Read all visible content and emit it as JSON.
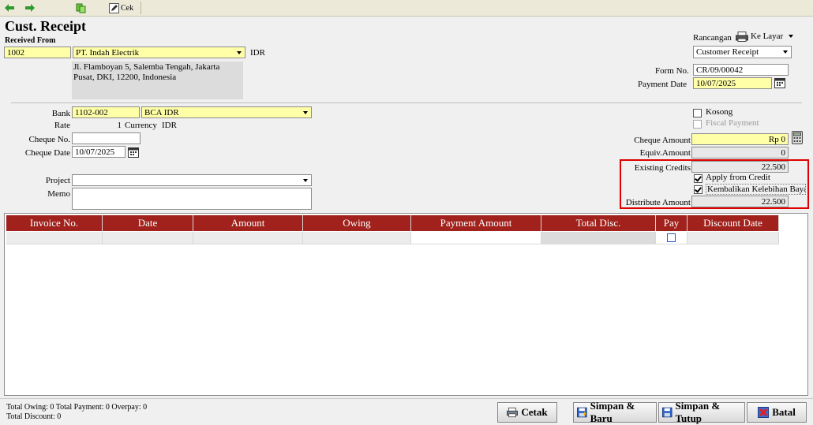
{
  "toolbar": {
    "cek_label": "Cek"
  },
  "header": {
    "title": "Cust. Receipt",
    "received_from_label": "Received From",
    "customer_code": "1002",
    "customer_name": "PT. Indah Electrik",
    "currency": "IDR",
    "address_line1": "Jl. Flamboyan 5, Salemba Tengah, Jakarta",
    "address_line2": "Pusat, DKI, 12200, Indonesia",
    "rancangan_label": "Rancangan",
    "ke_layar_label": "Ke Layar",
    "template_value": "Customer Receipt",
    "form_no_label": "Form No.",
    "form_no_value": "CR/09/00042",
    "payment_date_label": "Payment Date",
    "payment_date_value": "10/07/2025"
  },
  "bank": {
    "bank_label": "Bank",
    "bank_code": "1102-002",
    "bank_name": "BCA IDR",
    "rate_label": "Rate",
    "rate_value": "1",
    "currency_label": "Currency",
    "currency_value": "IDR",
    "cheque_no_label": "Cheque No.",
    "cheque_no_value": "",
    "cheque_date_label": "Cheque Date",
    "cheque_date_value": "10/07/2025",
    "project_label": "Project",
    "project_value": "",
    "memo_label": "Memo",
    "memo_value": ""
  },
  "right_panel": {
    "kosong_label": "Kosong",
    "fiscal_label": "Fiscal Payment",
    "cheque_amount_label": "Cheque Amount",
    "cheque_amount_value": "Rp 0",
    "equiv_amount_label": "Equiv.Amount",
    "equiv_amount_value": "0",
    "existing_credits_label": "Existing Credits",
    "existing_credits_value": "22.500",
    "apply_from_credit_label": "Apply from Credit",
    "kembalikan_label": "Kembalikan Kelebihan Baya",
    "distribute_amount_label": "Distribute Amount",
    "distribute_amount_value": "22.500"
  },
  "table": {
    "columns": [
      "Invoice No.",
      "Date",
      "Amount",
      "Owing",
      "Payment Amount",
      "Total Disc.",
      "Pay",
      "Discount Date"
    ]
  },
  "status": {
    "line1": "Total Owing: 0   Total Payment: 0   Overpay: 0",
    "line2": "Total Discount: 0"
  },
  "buttons": {
    "cetak": "Cetak",
    "simpan_baru": "Simpan & Baru",
    "simpan_tutup": "Simpan & Tutup",
    "batal": "Batal"
  },
  "colors": {
    "header_red": "#a1221c",
    "field_yellow": "#ffffa8",
    "highlight_box": "#e00000"
  }
}
